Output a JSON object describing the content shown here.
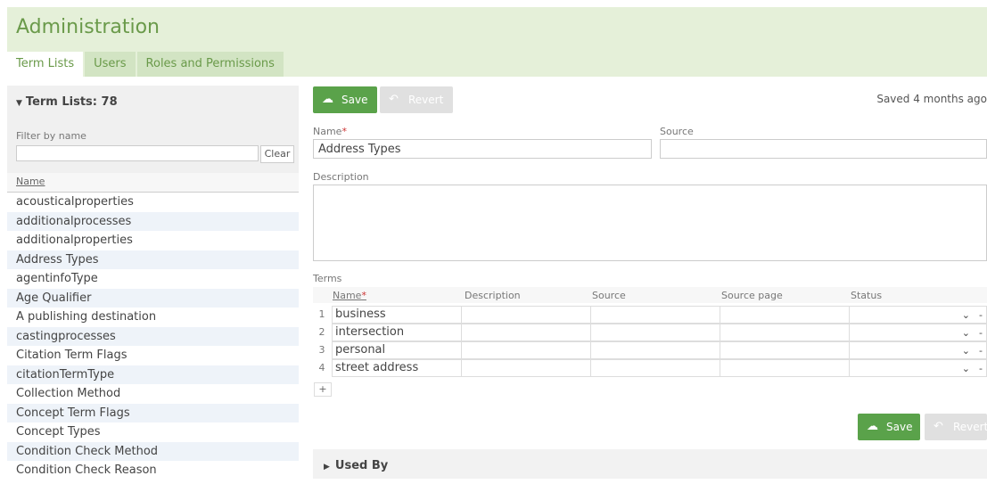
{
  "app": {
    "title": "Administration"
  },
  "tabs": [
    {
      "label": "Term Lists"
    },
    {
      "label": "Users"
    },
    {
      "label": "Roles and Permissions"
    }
  ],
  "sidebar": {
    "header": "Term Lists: 78",
    "filter_label": "Filter by name",
    "filter_value": "",
    "clear_label": "Clear",
    "column_header": "Name",
    "items": [
      "acousticalproperties",
      "additionalprocesses",
      "additionalproperties",
      "Address Types",
      "agentinfoType",
      "Age Qualifier",
      "A publishing destination",
      "castingprocesses",
      "Citation Term Flags",
      "citationTermType",
      "Collection Method",
      "Concept Term Flags",
      "Concept Types",
      "Condition Check Method",
      "Condition Check Reason"
    ]
  },
  "toolbar": {
    "save_label": "Save",
    "revert_label": "Revert",
    "saved_text": "Saved 4 months ago"
  },
  "form": {
    "name_label": "Name",
    "name_required": "*",
    "name_value": "Address Types",
    "source_label": "Source",
    "source_value": "",
    "description_label": "Description",
    "description_value": "",
    "terms_label": "Terms"
  },
  "terms": {
    "columns": [
      "Name",
      "Description",
      "Source",
      "Source page",
      "Status"
    ],
    "required_marker": "*",
    "rows": [
      {
        "num": "1",
        "name": "business"
      },
      {
        "num": "2",
        "name": "intersection"
      },
      {
        "num": "3",
        "name": "personal"
      },
      {
        "num": "4",
        "name": "street address"
      }
    ],
    "add_label": "+",
    "remove_label": "-"
  },
  "bottom_toolbar": {
    "save_label": "Save",
    "revert_label": "Revert"
  },
  "used_by": {
    "label": "Used By"
  },
  "colors": {
    "accent": "#5aa24a",
    "header_bg": "#e5f0d9",
    "title": "#6a9a4a"
  }
}
